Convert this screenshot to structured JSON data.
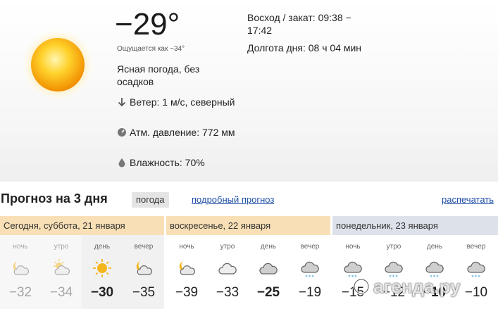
{
  "current": {
    "temperature": "−29°",
    "feels_like": "Ощущается как −34°",
    "condition": "Ясная погода, без осадков",
    "wind": "Ветер: 1 м/с, северный",
    "pressure": "Атм. давление: 772 мм",
    "humidity": "Влажность: 70%",
    "sunrise_sunset": "Восход / закат: 09:38 − 17:42",
    "day_length": "Долгота дня: 08 ч 04 мин",
    "icons": {
      "main": "sun-icon",
      "wind": "arrow-down-icon",
      "pressure": "gauge-icon",
      "humidity": "droplet-icon"
    }
  },
  "forecast": {
    "title": "Прогноз на 3 дня",
    "tab_active": "погода",
    "tab_link": "подробный прогноз",
    "print_link": "распечатать",
    "days": [
      {
        "header": "Сегодня, суббота, 21 января",
        "parts": [
          {
            "label": "ночь",
            "temp": "−32",
            "icon": "moon-cloud-icon"
          },
          {
            "label": "утро",
            "temp": "−34",
            "icon": "sun-cloud-icon"
          },
          {
            "label": "день",
            "temp": "−30",
            "icon": "sun-icon"
          },
          {
            "label": "вечер",
            "temp": "−35",
            "icon": "moon-cloud-icon"
          }
        ]
      },
      {
        "header": "воскресенье, 22 января",
        "parts": [
          {
            "label": "ночь",
            "temp": "−39",
            "icon": "moon-cloud-icon"
          },
          {
            "label": "утро",
            "temp": "−33",
            "icon": "cloud-icon"
          },
          {
            "label": "день",
            "temp": "−25",
            "icon": "cloud-icon"
          },
          {
            "label": "вечер",
            "temp": "−19",
            "icon": "snow-cloud-icon"
          }
        ]
      },
      {
        "header": "понедельник, 23 января",
        "parts": [
          {
            "label": "ночь",
            "temp": "−15",
            "icon": "snow-cloud-icon"
          },
          {
            "label": "утро",
            "temp": "−12",
            "icon": "snow-cloud-icon"
          },
          {
            "label": "день",
            "temp": "−10",
            "icon": "snow-cloud-icon"
          },
          {
            "label": "вечер",
            "temp": "−10",
            "icon": "snow-cloud-icon"
          }
        ]
      }
    ],
    "snow_mark": "***"
  },
  "watermark": "агенда.ру",
  "colors": {
    "today_header": "#f8dfb5",
    "future_header": "#dde2ea",
    "link": "#1f4ea8",
    "sun": "#f5b51c"
  }
}
